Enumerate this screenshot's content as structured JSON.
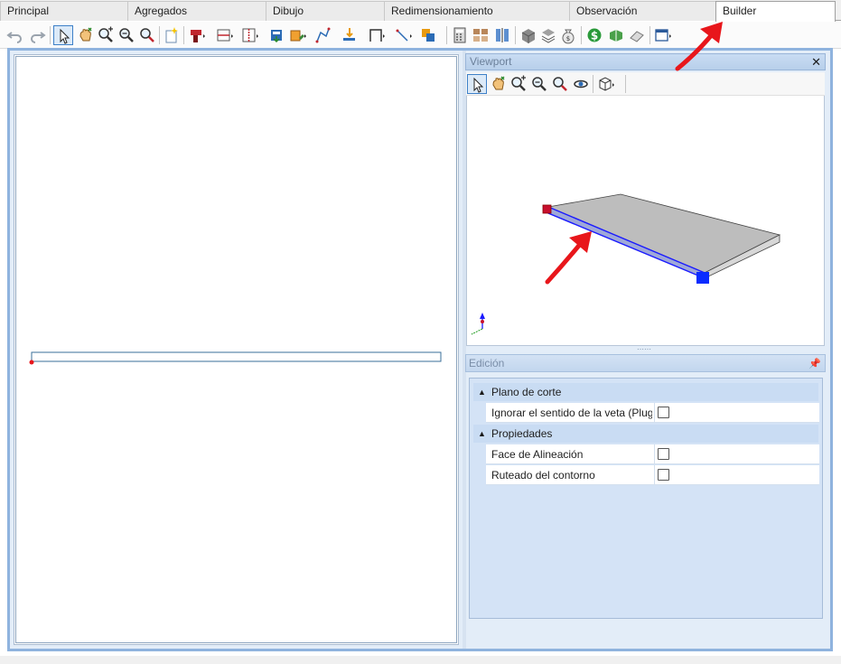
{
  "tabs": [
    {
      "label": "Principal",
      "active": false
    },
    {
      "label": "Agregados",
      "active": false
    },
    {
      "label": "Dibujo",
      "active": false
    },
    {
      "label": "Redimensionamiento",
      "active": false
    },
    {
      "label": "Observación",
      "active": false
    },
    {
      "label": "Builder",
      "active": true
    }
  ],
  "toolbar_icons": [
    "undo-icon",
    "redo-icon",
    "select-icon",
    "pan-icon",
    "zoom-in-icon",
    "zoom-out-icon",
    "zoom-extents-icon",
    "new-part-icon",
    "drill-icon",
    "horizontal-division-icon",
    "vertical-division-icon",
    "insert-hardware-icon",
    "edge-icon",
    "path-icon",
    "insert-down-icon",
    "frame-icon",
    "line-icon",
    "copy-icon",
    "calculator-icon",
    "panels-icon",
    "columns-icon",
    "box-icon",
    "layers-icon",
    "money-bag-icon",
    "price-icon",
    "material-icon",
    "eraser-icon",
    "window-icon"
  ],
  "viewport": {
    "title": "Viewport",
    "close_symbol": "✕",
    "toolbar_icons": [
      "select-icon",
      "pan-icon",
      "zoom-in-icon",
      "zoom-out-icon",
      "zoom-extents-icon",
      "orbit-icon",
      "view-cube-icon"
    ]
  },
  "edicion": {
    "title": "Edición",
    "pin_symbol": "📌",
    "categories": [
      {
        "label": "Plano de corte",
        "rows": [
          {
            "label": "Ignorar el sentido de la veta (Plug...",
            "checked": false
          }
        ]
      },
      {
        "label": "Propiedades",
        "rows": [
          {
            "label": "Face de Alineación",
            "checked": false
          },
          {
            "label": "Ruteado del contorno",
            "checked": false
          }
        ]
      }
    ]
  },
  "colors": {
    "accent": "#3d80c8",
    "panel_border": "#8fb3de",
    "annotation_arrow": "#e8161b",
    "edge_highlight": "#1a1aff",
    "corner_red": "#c8102e",
    "corner_blue": "#0a2cff"
  }
}
